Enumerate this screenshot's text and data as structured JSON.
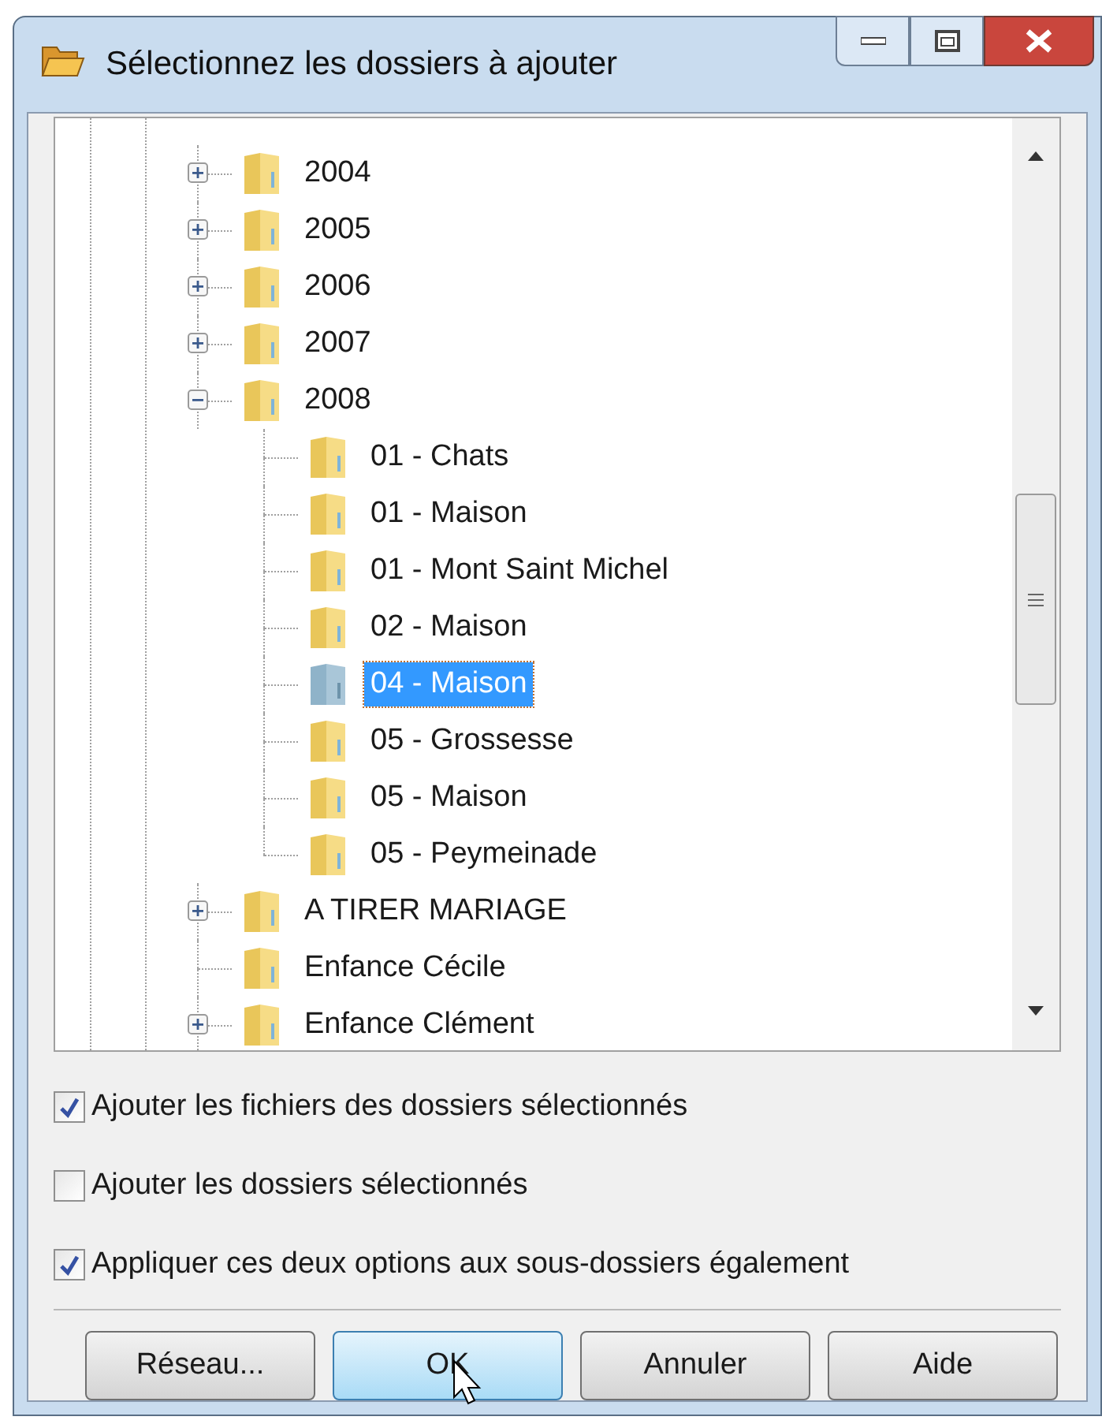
{
  "window": {
    "title": "Sélectionnez les dossiers à ajouter"
  },
  "tree": [
    {
      "label": "2004",
      "kind": "collapsed",
      "selected": false
    },
    {
      "label": "2005",
      "kind": "collapsed",
      "selected": false
    },
    {
      "label": "2006",
      "kind": "collapsed",
      "selected": false
    },
    {
      "label": "2007",
      "kind": "collapsed",
      "selected": false
    },
    {
      "label": "2008",
      "kind": "expanded",
      "selected": false,
      "children": [
        {
          "label": "01 - Chats",
          "kind": "leaf",
          "selected": false
        },
        {
          "label": "01 - Maison",
          "kind": "leaf",
          "selected": false
        },
        {
          "label": "01 - Mont Saint Michel",
          "kind": "leaf",
          "selected": false
        },
        {
          "label": "02 - Maison",
          "kind": "leaf",
          "selected": false
        },
        {
          "label": "04 - Maison",
          "kind": "leaf",
          "selected": true
        },
        {
          "label": "05 - Grossesse",
          "kind": "leaf",
          "selected": false
        },
        {
          "label": "05 - Maison",
          "kind": "leaf",
          "selected": false
        },
        {
          "label": "05 - Peymeinade",
          "kind": "leaf",
          "selected": false
        }
      ]
    },
    {
      "label": "A TIRER MARIAGE",
      "kind": "collapsed",
      "selected": false
    },
    {
      "label": "Enfance Cécile",
      "kind": "leaf",
      "selected": false
    },
    {
      "label": "Enfance Clément",
      "kind": "collapsed",
      "selected": false
    }
  ],
  "options": [
    {
      "label": "Ajouter les fichiers des dossiers sélectionnés",
      "checked": true
    },
    {
      "label": "Ajouter les dossiers sélectionnés",
      "checked": false
    },
    {
      "label": "Appliquer ces deux options aux sous-dossiers également",
      "checked": true
    }
  ],
  "buttons": [
    {
      "label": "Réseau...",
      "selected": false
    },
    {
      "label": "OK",
      "selected": true
    },
    {
      "label": "Annuler",
      "selected": false
    },
    {
      "label": "Aide",
      "selected": false
    }
  ]
}
